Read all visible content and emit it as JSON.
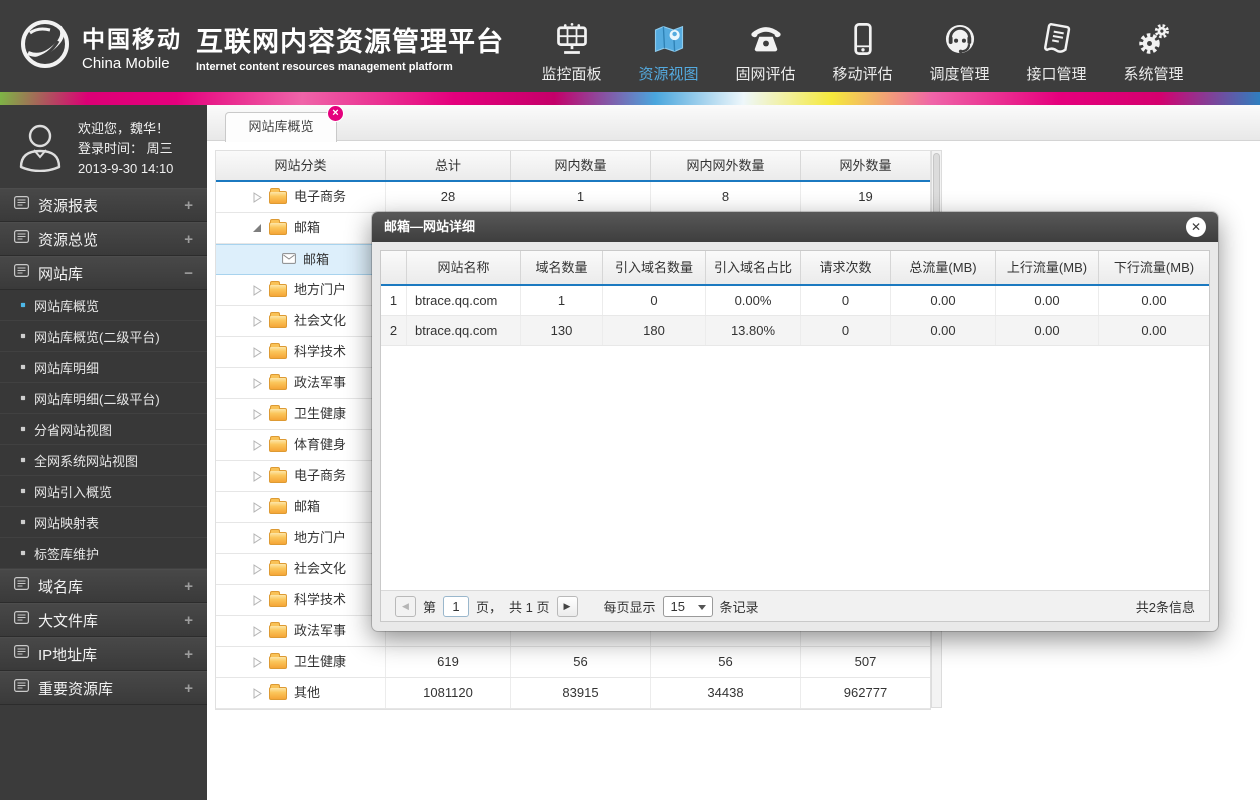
{
  "header": {
    "logo_cn": "中国移动",
    "logo_en": "China Mobile",
    "title": "互联网内容资源管理平台",
    "subtitle": "Internet content resources management platform",
    "nav": [
      {
        "label": "监控面板",
        "icon": "dashboard-icon",
        "active": false
      },
      {
        "label": "资源视图",
        "icon": "map-icon",
        "active": true
      },
      {
        "label": "固网评估",
        "icon": "phone-icon",
        "active": false
      },
      {
        "label": "移动评估",
        "icon": "mobile-icon",
        "active": false
      },
      {
        "label": "调度管理",
        "icon": "headset-icon",
        "active": false
      },
      {
        "label": "接口管理",
        "icon": "document-icon",
        "active": false
      },
      {
        "label": "系统管理",
        "icon": "gears-icon",
        "active": false
      }
    ]
  },
  "sidebar": {
    "welcome": "欢迎您，魏华！",
    "login_label": "登录时间： 周三",
    "login_datetime": "2013-9-30  14:10",
    "groups": [
      {
        "label": "资源报表",
        "icon": "document-icon",
        "expand": "+",
        "children": [],
        "active_child": -1
      },
      {
        "label": "资源总览",
        "icon": "document-icon",
        "expand": "+",
        "children": [],
        "active_child": -1
      },
      {
        "label": "网站库",
        "icon": "document-icon",
        "expand": "−",
        "active_child": 0,
        "children": [
          "网站库概览",
          "网站库概览(二级平台)",
          "网站库明细",
          "网站库明细(二级平台)",
          "分省网站视图",
          "全网系统网站视图",
          "网站引入概览",
          "网站映射表",
          "标签库维护"
        ]
      },
      {
        "label": "域名库",
        "icon": "document-icon",
        "expand": "+",
        "children": [],
        "active_child": -1
      },
      {
        "label": "大文件库",
        "icon": "document-icon",
        "expand": "+",
        "children": [],
        "active_child": -1
      },
      {
        "label": "IP地址库",
        "icon": "document-icon",
        "expand": "+",
        "children": [],
        "active_child": -1
      },
      {
        "label": "重要资源库",
        "icon": "document-icon",
        "expand": "+",
        "children": [],
        "active_child": -1
      }
    ]
  },
  "tab": {
    "label": "网站库概览",
    "close": "×"
  },
  "main_table": {
    "headers": [
      "网站分类",
      "总计",
      "网内数量",
      "网内网外数量",
      "网外数量"
    ],
    "rows": [
      {
        "label": "电子商务",
        "level": 1,
        "state": "collapsed",
        "selected": false,
        "values": [
          "28",
          "1",
          "8",
          "19"
        ]
      },
      {
        "label": "邮箱",
        "level": 1,
        "state": "expanded",
        "selected": false,
        "values": [
          "",
          "",
          "",
          ""
        ]
      },
      {
        "label": "邮箱",
        "level": 2,
        "state": "leaf",
        "selected": true,
        "values": [
          "",
          "",
          "",
          ""
        ]
      },
      {
        "label": "地方门户",
        "level": 1,
        "state": "collapsed",
        "selected": false,
        "values": [
          "",
          "",
          "",
          ""
        ]
      },
      {
        "label": "社会文化",
        "level": 1,
        "state": "collapsed",
        "selected": false,
        "values": [
          "",
          "",
          "",
          ""
        ]
      },
      {
        "label": "科学技术",
        "level": 1,
        "state": "collapsed",
        "selected": false,
        "values": [
          "",
          "",
          "",
          ""
        ]
      },
      {
        "label": "政法军事",
        "level": 1,
        "state": "collapsed",
        "selected": false,
        "values": [
          "",
          "",
          "",
          ""
        ]
      },
      {
        "label": "卫生健康",
        "level": 1,
        "state": "collapsed",
        "selected": false,
        "values": [
          "",
          "",
          "",
          ""
        ]
      },
      {
        "label": "体育健身",
        "level": 1,
        "state": "collapsed",
        "selected": false,
        "values": [
          "",
          "",
          "",
          ""
        ]
      },
      {
        "label": "电子商务",
        "level": 1,
        "state": "collapsed",
        "selected": false,
        "values": [
          "",
          "",
          "",
          ""
        ]
      },
      {
        "label": "邮箱",
        "level": 1,
        "state": "collapsed",
        "selected": false,
        "values": [
          "",
          "",
          "",
          ""
        ]
      },
      {
        "label": "地方门户",
        "level": 1,
        "state": "collapsed",
        "selected": false,
        "values": [
          "",
          "",
          "",
          ""
        ]
      },
      {
        "label": "社会文化",
        "level": 1,
        "state": "collapsed",
        "selected": false,
        "values": [
          "",
          "",
          "",
          ""
        ]
      },
      {
        "label": "科学技术",
        "level": 1,
        "state": "collapsed",
        "selected": false,
        "values": [
          "",
          "",
          "",
          ""
        ]
      },
      {
        "label": "政法军事",
        "level": 1,
        "state": "collapsed",
        "selected": false,
        "values": [
          "",
          "",
          "",
          ""
        ]
      },
      {
        "label": "卫生健康",
        "level": 1,
        "state": "collapsed",
        "selected": false,
        "values": [
          "619",
          "56",
          "56",
          "507"
        ]
      },
      {
        "label": "其他",
        "level": 1,
        "state": "collapsed",
        "selected": false,
        "values": [
          "1081120",
          "83915",
          "34438",
          "962777"
        ]
      }
    ]
  },
  "modal": {
    "title": "邮箱—网站详细",
    "close": "✕",
    "table": {
      "headers": [
        "",
        "网站名称",
        "域名数量",
        "引入域名数量",
        "引入域名占比",
        "请求次数",
        "总流量(MB)",
        "上行流量(MB)",
        "下行流量(MB)"
      ],
      "rows": [
        [
          "1",
          "btrace.qq.com",
          "1",
          "0",
          "0.00%",
          "0",
          "0.00",
          "0.00",
          "0.00"
        ],
        [
          "2",
          "btrace.qq.com",
          "130",
          "180",
          "13.80%",
          "0",
          "0.00",
          "0.00",
          "0.00"
        ]
      ]
    },
    "pagination": {
      "prev": "◀",
      "next": "▶",
      "page_prefix": "第",
      "page_value": "1",
      "page_suffix": "页，",
      "total_pages": "共 1 页",
      "per_page_prefix": "每页显示",
      "per_page_value": "15",
      "per_page_suffix": "条记录",
      "total_info": "共2条信息"
    }
  },
  "colors": {
    "header_bg": "#3d3d3d",
    "accent_blue": "#1b79c0",
    "nav_active": "#54aadf",
    "stripe_magenta": "#e5007d",
    "folder_orange": "#f5a637",
    "selected_row": "#ddeffb",
    "tab_close_badge": "#e5007d"
  }
}
